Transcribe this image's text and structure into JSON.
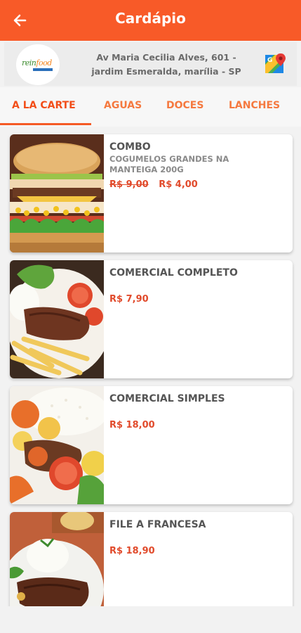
{
  "header": {
    "title": "Cardápio",
    "back_icon": "arrow-left-icon",
    "background": "#f85a28"
  },
  "store": {
    "logo_word1": "rein",
    "logo_word2": "food",
    "address_line1": "Av Maria Cecilia Alves, 601 -",
    "address_line2": "jardim Esmeralda, marília - SP",
    "maps_icon": "google-maps-icon"
  },
  "tabs": [
    {
      "label": "A LA CARTE",
      "active": true
    },
    {
      "label": "AGUAS",
      "active": false
    },
    {
      "label": "DOCES",
      "active": false
    },
    {
      "label": "LANCHES",
      "active": false
    }
  ],
  "items": [
    {
      "name": "COMBO",
      "description": "COGUMELOS GRANDES NA MANTEIGA 200G",
      "old_price": "R$ 9,00",
      "price": "R$ 4,00",
      "image": "burger-image"
    },
    {
      "name": "COMERCIAL COMPLETO",
      "description": "",
      "old_price": "",
      "price": "R$ 7,90",
      "image": "steak-fries-plate-image"
    },
    {
      "name": "COMERCIAL SIMPLES",
      "description": "",
      "old_price": "",
      "price": "R$ 18,00",
      "image": "rice-stew-plate-image"
    },
    {
      "name": "FILE A FRANCESA",
      "description": "",
      "old_price": "",
      "price": "R$ 18,90",
      "image": "filet-rice-plate-image"
    }
  ],
  "colors": {
    "accent": "#f85a28",
    "tab_text": "#f5793f",
    "price": "#e14b2c"
  }
}
